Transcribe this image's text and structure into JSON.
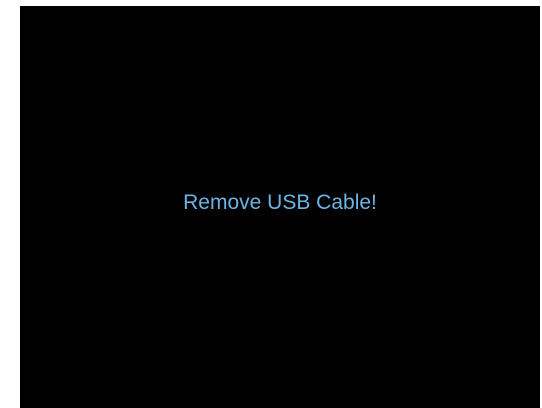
{
  "screen": {
    "message": "Remove USB Cable!"
  },
  "colors": {
    "background": "#000000",
    "message_text": "#6cb4e2"
  }
}
